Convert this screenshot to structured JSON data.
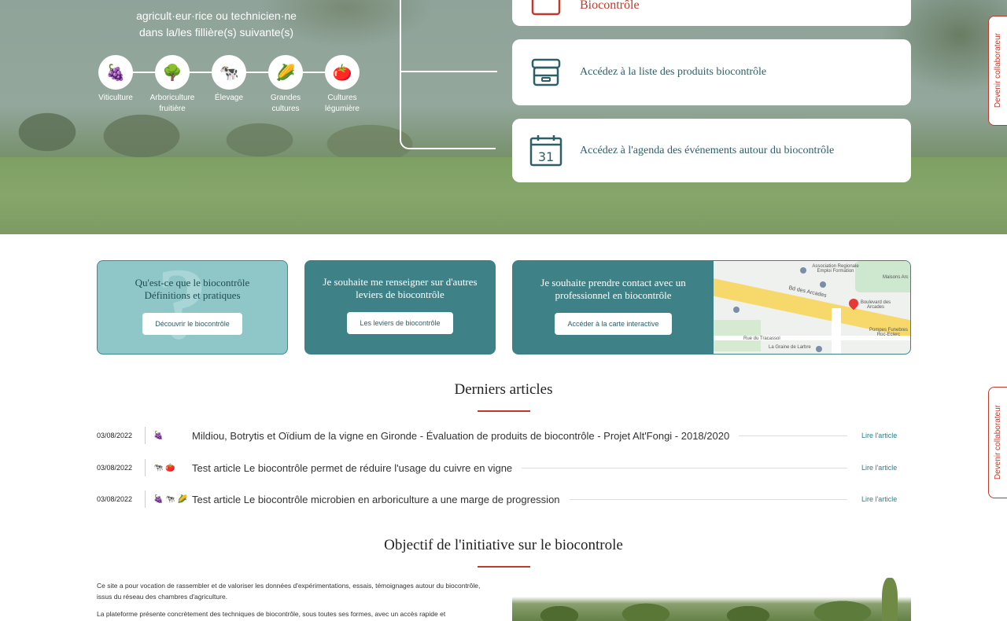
{
  "hero": {
    "intro_line1": "agricult·eur·rice ou technicien·ne",
    "intro_line2": "dans la/les fillière(s) suivante(s)",
    "filieres": [
      {
        "label": "Viticulture",
        "icon": "grape-icon",
        "glyph": "🍇"
      },
      {
        "label": "Arboriculture fruitière",
        "icon": "tree-icon",
        "glyph": "🌳"
      },
      {
        "label": "Élevage",
        "icon": "cow-icon",
        "glyph": "🐄"
      },
      {
        "label": "Grandes cultures",
        "icon": "corn-icon",
        "glyph": "🌽"
      },
      {
        "label": "Cultures légumière",
        "icon": "tomato-icon",
        "glyph": "🍅"
      }
    ],
    "cards": [
      {
        "text": "Biocontrôle",
        "icon": "book-icon"
      },
      {
        "text": "Accédez à la liste des produits biocontrôle",
        "icon": "archive-box-icon"
      },
      {
        "text": "Accédez à l'agenda des événements autour du biocontrôle",
        "icon": "calendar-icon",
        "calendar_day": "31"
      }
    ]
  },
  "collaborate_tab": {
    "label": "Devenir collaborateur",
    "icon": "eye-icon"
  },
  "cta": {
    "card1": {
      "line1": "Qu'est-ce que le biocontrôle",
      "line2": "Définitions et pratiques",
      "button": "Découvrir le biocontrôle",
      "watermark": "?"
    },
    "card2": {
      "line1": "Je souhaite me renseigner sur d'autres",
      "line2": "leviers de biocontrôle",
      "button": "Les leviers de biocontrôle"
    },
    "card3": {
      "line1": "Je souhaite prendre contact avec un",
      "line2": "professionnel en biocontrôle",
      "button": "Accéder à la carte interactive"
    },
    "map_labels": [
      "Bd des Arcades",
      "Boulevard des Arcades",
      "La Graine de Larbre",
      "Rue du Tracassol",
      "Pompes Funebres Roc-Eclerc",
      "Association Regionale Emploi Formation",
      "Maisons Arc"
    ]
  },
  "articles": {
    "title": "Derniers articles",
    "items": [
      {
        "date": "03/08/2022",
        "icons": "🍇",
        "title": "Mildiou, Botrytis et Oïdium de la vigne en Gironde - Évaluation de produits de biocontrôle - Projet Alt'Fongi - 2018/2020",
        "link": "Lire l'article"
      },
      {
        "date": "03/08/2022",
        "icons": "🐄 🍅",
        "title": "Test article Le biocontrôle permet de réduire l'usage du cuivre en vigne",
        "link": "Lire l'article"
      },
      {
        "date": "03/08/2022",
        "icons": "🍇 🐄 🌽",
        "title": "Test article Le biocontrôle microbien en arboriculture a une marge de progression",
        "link": "Lire l'article"
      }
    ]
  },
  "objectif": {
    "title": "Objectif de l'initiative sur le biocontrole",
    "p1": "Ce site a pour vocation de rassembler et de valoriser les données d'expérimentations, essais, témoignages autour du biocontrôle, issus du réseau des chambres d'agriculture.",
    "p2": "La plateforme présente concrètement des techniques de biocontrôle, sous toutes ses formes, avec un accès rapide et"
  },
  "colors": {
    "teal": "#3e8287",
    "light_teal": "#8fc7c9",
    "red": "#c0392b",
    "link": "#2d7f86"
  }
}
